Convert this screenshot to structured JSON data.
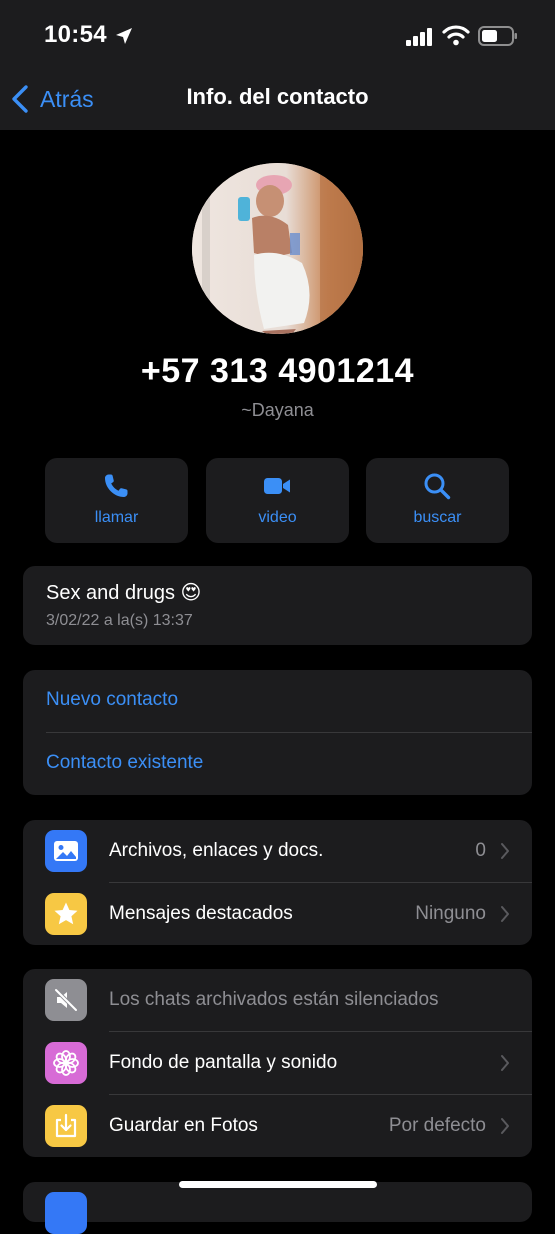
{
  "status_bar": {
    "time": "10:54"
  },
  "nav": {
    "back_label": "Atrás",
    "title": "Info. del contacto"
  },
  "contact": {
    "phone": "+57 313 4901214",
    "alias": "~Dayana"
  },
  "actions": [
    {
      "label": "llamar",
      "icon": "phone-icon"
    },
    {
      "label": "video",
      "icon": "video-icon"
    },
    {
      "label": "buscar",
      "icon": "search-icon"
    }
  ],
  "status": {
    "text": "Sex and drugs 😍",
    "date": "3/02/22 a la(s) 13:37"
  },
  "contact_links": [
    "Nuevo contacto",
    "Contacto existente"
  ],
  "media_section": [
    {
      "label": "Archivos, enlaces y docs.",
      "value": "0",
      "icon": "photo-icon",
      "color": "#3478f6"
    },
    {
      "label": "Mensajes destacados",
      "value": "Ninguno",
      "icon": "star-icon",
      "color": "#f7c844"
    }
  ],
  "settings_section": [
    {
      "label": "Los chats archivados están silenciados",
      "value": "",
      "icon": "muted-speaker-icon",
      "color": "#8e8e93"
    },
    {
      "label": "Fondo de pantalla y sonido",
      "value": "",
      "icon": "flower-icon",
      "color": "#d76bd6"
    },
    {
      "label": "Guardar en Fotos",
      "value": "Por defecto",
      "icon": "download-icon",
      "color": "#f7c844"
    }
  ],
  "colors": {
    "accent": "#3b8ff6",
    "background": "#000000",
    "card": "#1c1c1e",
    "secondary_text": "#8e8e93"
  }
}
